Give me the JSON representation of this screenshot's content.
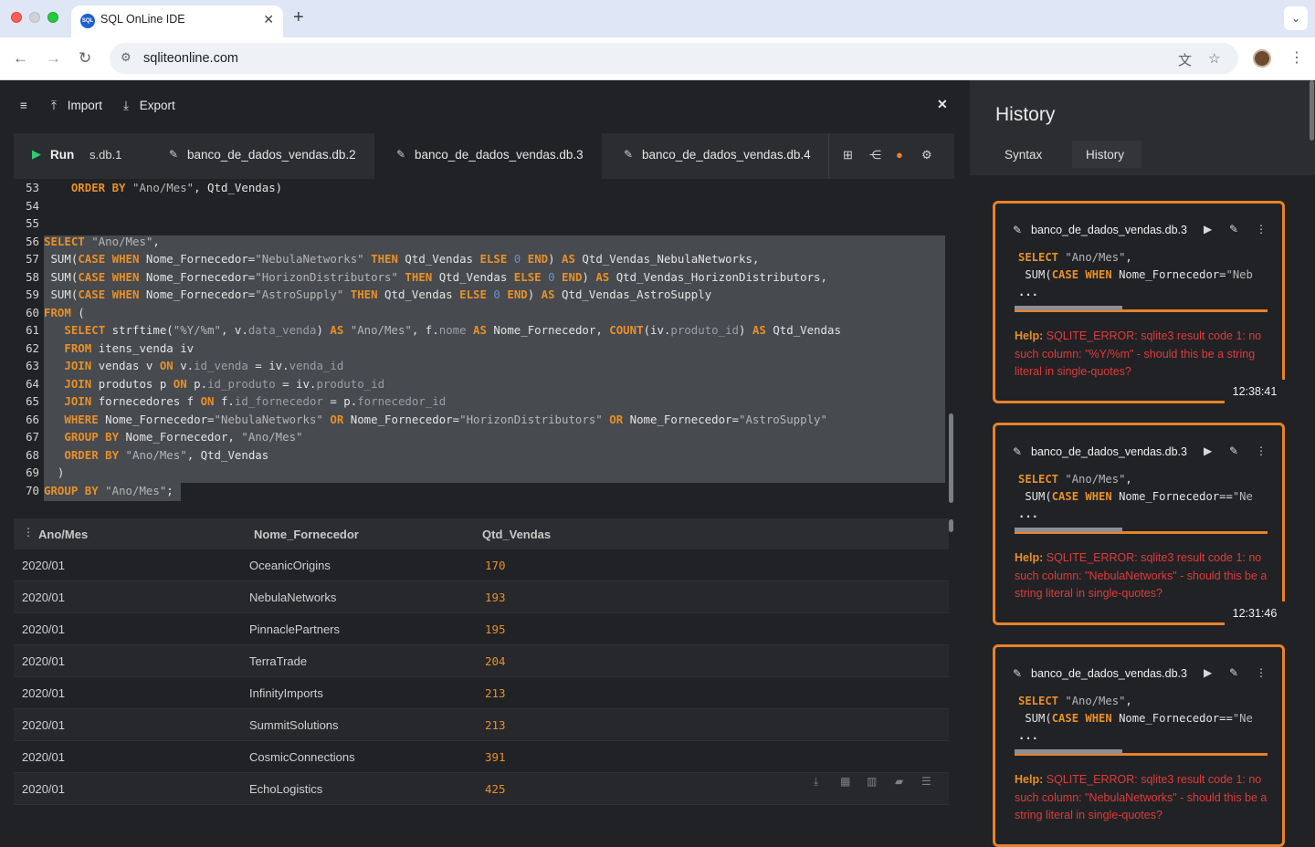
{
  "browser": {
    "tab_title": "SQL OnLine IDE",
    "favicon": "SQL",
    "url": "sqliteonline.com"
  },
  "app": {
    "topbar": {
      "import_label": "Import",
      "export_label": "Export"
    },
    "run": {
      "label": "Run",
      "db": "s.db.1"
    },
    "tabs": [
      {
        "label": "banco_de_dados_vendas.db.2"
      },
      {
        "label": "banco_de_dados_vendas.db.3"
      },
      {
        "label": "banco_de_dados_vendas.db.4"
      }
    ],
    "editor": {
      "line_numbers": [
        "53",
        "54",
        "55",
        "56",
        "57",
        "58",
        "59",
        "60",
        "61",
        "62",
        "63",
        "64",
        "65",
        "66",
        "67",
        "68",
        "69",
        "70"
      ]
    },
    "results": {
      "columns": [
        "Ano/Mes",
        "Nome_Fornecedor",
        "Qtd_Vendas"
      ],
      "rows": [
        [
          "2020/01",
          "OceanicOrigins",
          "170"
        ],
        [
          "2020/01",
          "NebulaNetworks",
          "193"
        ],
        [
          "2020/01",
          "PinnaclePartners",
          "195"
        ],
        [
          "2020/01",
          "TerraTrade",
          "204"
        ],
        [
          "2020/01",
          "InfinityImports",
          "213"
        ],
        [
          "2020/01",
          "SummitSolutions",
          "213"
        ],
        [
          "2020/01",
          "CosmicConnections",
          "391"
        ],
        [
          "2020/01",
          "EchoLogistics",
          "425"
        ]
      ]
    }
  },
  "history": {
    "title": "History",
    "tabs": [
      "Syntax",
      "History"
    ],
    "cards": [
      {
        "db": "banco_de_dados_vendas.db.3",
        "code1": "SELECT \"Ano/Mes\",",
        "code2": " SUM(CASE WHEN Nome_Fornecedor=\"Neb",
        "code3": "...",
        "help_label": "Help:",
        "help_text": "SQLITE_ERROR: sqlite3 result code 1: no such column: \"%Y/%m\" - should this be a string literal in single-quotes?",
        "time": "12:38:41"
      },
      {
        "db": "banco_de_dados_vendas.db.3",
        "code1": "SELECT \"Ano/Mes\",",
        "code2": " SUM(CASE WHEN Nome_Fornecedor==\"Ne",
        "code3": "...",
        "help_label": "Help:",
        "help_text": "SQLITE_ERROR: sqlite3 result code 1: no such column: \"NebulaNetworks\" - should this be a string literal in single-quotes?",
        "time": "12:31:46"
      },
      {
        "db": "banco_de_dados_vendas.db.3",
        "code1": "SELECT \"Ano/Mes\",",
        "code2": " SUM(CASE WHEN Nome_Fornecedor==\"Ne",
        "code3": "...",
        "help_label": "Help:",
        "help_text": "SQLITE_ERROR: sqlite3 result code 1: no such column: \"NebulaNetworks\" - should this be a string literal in single-quotes?",
        "time": ""
      }
    ]
  },
  "colors": {
    "accent": "#e8822a",
    "error": "#e03b3b",
    "run_green": "#2ecc71",
    "background": "#202225"
  }
}
